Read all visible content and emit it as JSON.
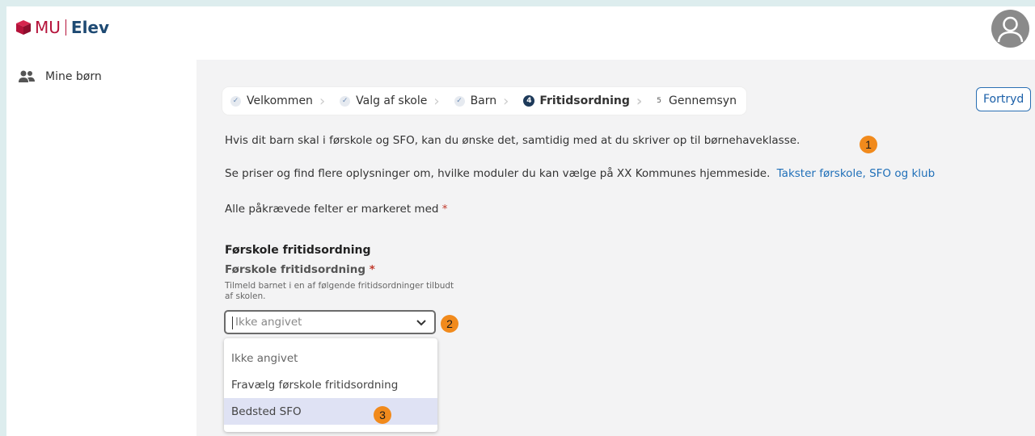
{
  "app": {
    "logo_mu": "MU",
    "logo_elev": "Elev",
    "brand_color": "#b5123a"
  },
  "sidebar": {
    "items": [
      {
        "label": "Mine børn",
        "icon": "users-icon"
      }
    ]
  },
  "stepper": {
    "steps": [
      {
        "label": "Velkommen",
        "state": "done"
      },
      {
        "label": "Valg af skole",
        "state": "done"
      },
      {
        "label": "Barn",
        "state": "done"
      },
      {
        "label": "Fritidsordning",
        "state": "active",
        "number": "4"
      },
      {
        "label": "Gennemsyn",
        "state": "upcoming",
        "number": "5"
      }
    ]
  },
  "actions": {
    "cancel_label": "Fortryd"
  },
  "content": {
    "intro": "Hvis dit barn skal i førskole og SFO, kan du ønske det, samtidig med at du skriver op til børnehaveklasse.",
    "prices_text": "Se priser og find flere oplysninger om, hvilke moduler du kan vælge på XX Kommunes hjemmeside.",
    "prices_link": "Takster førskole, SFO og klub",
    "required_note": "Alle påkrævede felter er markeret med",
    "required_marker": "*",
    "section_title": "Førskole fritidsordning",
    "field_label": "Førskole fritidsordning",
    "field_help": "Tilmeld barnet i en af følgende fritidsordninger tilbudt af skolen."
  },
  "select": {
    "placeholder": "Ikke angivet",
    "options": [
      "Ikke angivet",
      "Fravælg førskole fritidsordning",
      "Bedsted SFO"
    ],
    "highlighted_index": 2
  },
  "callouts": [
    "1",
    "2",
    "3"
  ]
}
